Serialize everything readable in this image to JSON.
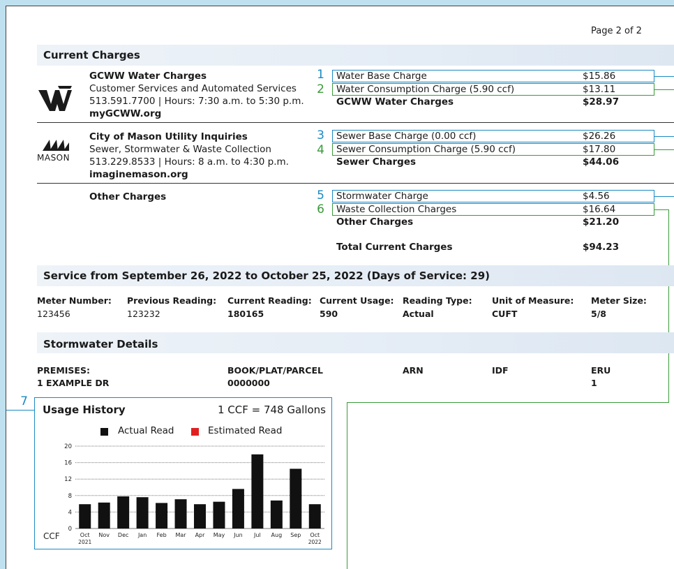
{
  "page_label": "Page 2 of 2",
  "current_charges": {
    "title": "Current Charges",
    "providers": [
      {
        "name": "GCWW Water Charges",
        "line1": "Customer Services and Automated Services",
        "line2": "513.591.7700 | Hours: 7:30 a.m. to 5:30 p.m.",
        "website": "myGCWW.org",
        "logo_label": ""
      },
      {
        "name": "City of Mason Utility Inquiries",
        "line1": "Sewer, Stormwater & Waste Collection",
        "line2": "513.229.8533 | Hours: 8 a.m. to 4:30 p.m.",
        "website": "imaginemason.org",
        "logo_label": "MASON"
      },
      {
        "name": "Other Charges"
      }
    ],
    "lines": [
      {
        "marker": "1",
        "label": "Water Base Charge",
        "amount": "$15.86"
      },
      {
        "marker": "2",
        "label": "Water Consumption Charge (5.90 ccf)",
        "amount": "$13.11"
      },
      {
        "label": "GCWW Water Charges",
        "amount": "$28.97"
      },
      {
        "marker": "3",
        "label": "Sewer Base Charge (0.00 ccf)",
        "amount": "$26.26"
      },
      {
        "marker": "4",
        "label": "Sewer Consumption Charge (5.90 ccf)",
        "amount": "$17.80"
      },
      {
        "label": "Sewer Charges",
        "amount": "$44.06"
      },
      {
        "marker": "5",
        "label": "Stormwater Charge",
        "amount": "$4.56"
      },
      {
        "marker": "6",
        "label": "Waste Collection Charges",
        "amount": "$16.64"
      },
      {
        "label": "Other Charges",
        "amount": "$21.20"
      },
      {
        "label": "Total Current Charges",
        "amount": "$94.23"
      }
    ]
  },
  "service": {
    "title": "Service from September 26, 2022 to October 25, 2022 (Days of Service: 29)",
    "columns": [
      "Meter Number:",
      "Previous Reading:",
      "Current Reading:",
      "Current Usage:",
      "Reading Type:",
      "Unit of Measure:",
      "Meter Size:"
    ],
    "values": [
      "123456",
      "123232",
      "180165",
      "590",
      "Actual",
      "CUFT",
      "5/8"
    ]
  },
  "stormwater": {
    "title": "Stormwater Details",
    "columns": [
      "PREMISES:",
      "BOOK/PLAT/PARCEL",
      "ARN",
      "IDF",
      "ERU"
    ],
    "values": [
      "1 EXAMPLE DR",
      "0000000",
      "",
      "",
      "1"
    ]
  },
  "usage_history": {
    "marker": "7",
    "title": "Usage History",
    "conversion": "1 CCF = 748 Gallons",
    "colors": {
      "actual": "#111111",
      "estimated": "#e02020",
      "accent": "#1a8ac4",
      "green": "#3a9a3a"
    }
  },
  "chart_data": {
    "type": "bar",
    "ylabel": "CCF",
    "ylim": [
      0,
      20
    ],
    "yticks": [
      "0",
      "4",
      "8",
      "12",
      "16",
      "20"
    ],
    "categories": [
      "Oct",
      "Nov",
      "Dec",
      "Jan",
      "Feb",
      "Mar",
      "Apr",
      "May",
      "Jun",
      "Jul",
      "Aug",
      "Sep",
      "Oct"
    ],
    "year_labels": [
      "2021",
      "2022"
    ],
    "series": [
      {
        "name": "Actual Read",
        "values": [
          5.9,
          6.3,
          7.8,
          7.6,
          6.2,
          7.1,
          5.9,
          6.5,
          9.6,
          18.0,
          6.8,
          14.5,
          5.9
        ]
      },
      {
        "name": "Estimated Read",
        "values": [
          0,
          0,
          0,
          0,
          0,
          0,
          0,
          0,
          0,
          0,
          0,
          0,
          0
        ]
      }
    ],
    "grid": true,
    "legend": "top"
  }
}
